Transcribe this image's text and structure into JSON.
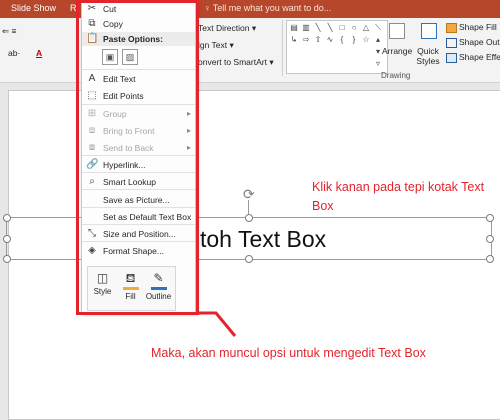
{
  "ribbon": {
    "tabs": [
      "Slide Show",
      "R"
    ],
    "tell_me": "Tell me what you want to do...",
    "text_direction": "Text Direction",
    "align_text": "ign Text",
    "convert_smartart": "onvert to SmartArt",
    "arrange": "Arrange",
    "quick_styles": "Quick Styles",
    "shape_fill": "Shape Fill",
    "shape_outline": "Shape Outli",
    "shape_effects": "Shape Effec",
    "drawing_group": "Drawing",
    "font_color_letter": "A"
  },
  "slide": {
    "text_box_text": "toh Text Box"
  },
  "annotations": {
    "note_right": "Klik kanan pada tepi kotak Text Box",
    "note_bottom": "Maka, akan muncul opsi untuk mengedit Text Box"
  },
  "context_menu": {
    "cut": "Cut",
    "copy": "Copy",
    "paste_options": "Paste Options:",
    "edit_text": "Edit Text",
    "edit_points": "Edit Points",
    "group": "Group",
    "bring_to_front": "Bring to Front",
    "send_to_back": "Send to Back",
    "hyperlink": "Hyperlink...",
    "smart_lookup": "Smart Lookup",
    "save_as_picture": "Save as Picture...",
    "set_default": "Set as Default Text Box",
    "size_position": "Size and Position...",
    "format_shape": "Format Shape..."
  },
  "mini_toolbar": {
    "style": "Style",
    "fill": "Fill",
    "outline": "Outline",
    "fill_color": "#f4a940",
    "outline_color": "#2e75b6"
  },
  "colors": {
    "accent": "#b7472a",
    "annotation": "#e3242b"
  }
}
